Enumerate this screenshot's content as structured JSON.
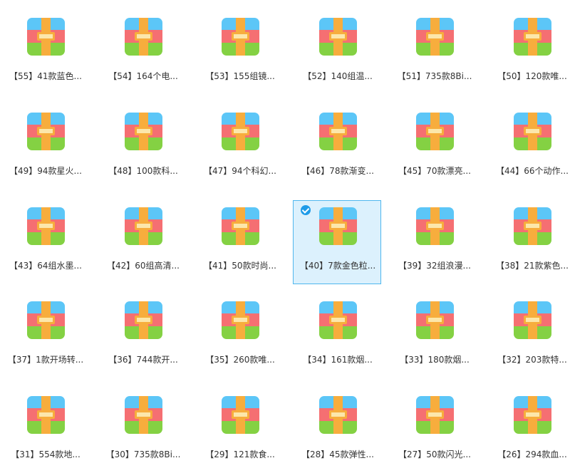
{
  "files": [
    {
      "label": "【55】41款蓝色...",
      "selected": false
    },
    {
      "label": "【54】164个电...",
      "selected": false
    },
    {
      "label": "【53】155组镜...",
      "selected": false
    },
    {
      "label": "【52】140组温...",
      "selected": false
    },
    {
      "label": "【51】735款8Bi...",
      "selected": false
    },
    {
      "label": "【50】120款唯...",
      "selected": false
    },
    {
      "label": "【49】94款星火...",
      "selected": false
    },
    {
      "label": "【48】100款科...",
      "selected": false
    },
    {
      "label": "【47】94个科幻...",
      "selected": false
    },
    {
      "label": "【46】78款渐变...",
      "selected": false
    },
    {
      "label": "【45】70款漂亮...",
      "selected": false
    },
    {
      "label": "【44】66个动作...",
      "selected": false
    },
    {
      "label": "【43】64组水墨...",
      "selected": false
    },
    {
      "label": "【42】60组高清...",
      "selected": false
    },
    {
      "label": "【41】50款时尚...",
      "selected": false
    },
    {
      "label": "【40】7款金色粒...",
      "selected": true
    },
    {
      "label": "【39】32组浪漫...",
      "selected": false
    },
    {
      "label": "【38】21款紫色...",
      "selected": false
    },
    {
      "label": "【37】1款开场转...",
      "selected": false
    },
    {
      "label": "【36】744款开...",
      "selected": false
    },
    {
      "label": "【35】260款唯...",
      "selected": false
    },
    {
      "label": "【34】161款烟...",
      "selected": false
    },
    {
      "label": "【33】180款烟...",
      "selected": false
    },
    {
      "label": "【32】203款特...",
      "selected": false
    },
    {
      "label": "【31】554款地...",
      "selected": false
    },
    {
      "label": "【30】735款8Bi...",
      "selected": false
    },
    {
      "label": "【29】121款食...",
      "selected": false
    },
    {
      "label": "【28】45款弹性...",
      "selected": false
    },
    {
      "label": "【27】50款闪光...",
      "selected": false
    },
    {
      "label": "【26】294款血...",
      "selected": false
    }
  ],
  "icon": "archive-icon",
  "colors": {
    "selection_bg": "#dcf1fd",
    "selection_border": "#4fb7ee",
    "check": "#1e9be8",
    "band_top": "#5cc6f7",
    "band_middle": "#f56f72",
    "band_bottom": "#84d143",
    "strap": "#f7ad3d"
  }
}
